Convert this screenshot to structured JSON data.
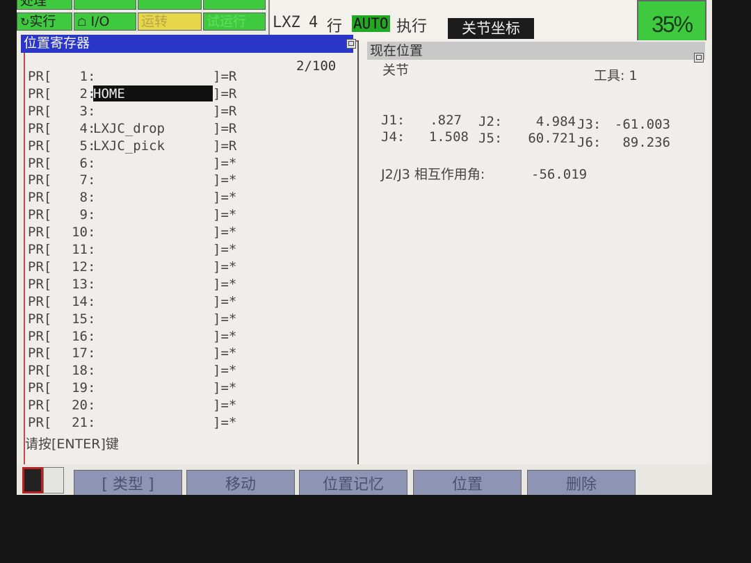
{
  "status_bar": {
    "buttons_row1": [
      "处理",
      "",
      "",
      ""
    ],
    "buttons_row2": [
      "实行",
      "I/O",
      "运转",
      "试运行"
    ],
    "program": "LXZ",
    "line_number": "4",
    "line_label": "行",
    "mode": "AUTO",
    "exec_state": "执行",
    "coord_mode": "关节坐标",
    "override": "35%"
  },
  "left_panel": {
    "title": "位置寄存器",
    "page_counter": "2/100",
    "prefix": "PR[",
    "rows": [
      {
        "num": "1",
        "comment": "",
        "suffix": "]=R"
      },
      {
        "num": "2",
        "comment": "HOME",
        "suffix": "]=R",
        "selected": true
      },
      {
        "num": "3",
        "comment": "",
        "suffix": "]=R"
      },
      {
        "num": "4",
        "comment": "LXJC_drop",
        "suffix": "]=R"
      },
      {
        "num": "5",
        "comment": "LXJC_pick",
        "suffix": "]=R"
      },
      {
        "num": "6",
        "comment": "",
        "suffix": "]=*"
      },
      {
        "num": "7",
        "comment": "",
        "suffix": "]=*"
      },
      {
        "num": "8",
        "comment": "",
        "suffix": "]=*"
      },
      {
        "num": "9",
        "comment": "",
        "suffix": "]=*"
      },
      {
        "num": "10",
        "comment": "",
        "suffix": "]=*"
      },
      {
        "num": "11",
        "comment": "",
        "suffix": "]=*"
      },
      {
        "num": "12",
        "comment": "",
        "suffix": "]=*"
      },
      {
        "num": "13",
        "comment": "",
        "suffix": "]=*"
      },
      {
        "num": "14",
        "comment": "",
        "suffix": "]=*"
      },
      {
        "num": "15",
        "comment": "",
        "suffix": "]=*"
      },
      {
        "num": "16",
        "comment": "",
        "suffix": "]=*"
      },
      {
        "num": "17",
        "comment": "",
        "suffix": "]=*"
      },
      {
        "num": "18",
        "comment": "",
        "suffix": "]=*"
      },
      {
        "num": "19",
        "comment": "",
        "suffix": "]=*"
      },
      {
        "num": "20",
        "comment": "",
        "suffix": "]=*"
      },
      {
        "num": "21",
        "comment": "",
        "suffix": "]=*"
      }
    ],
    "prompt": "请按[ENTER]键"
  },
  "right_panel": {
    "title": "现在位置",
    "position_type": "关节",
    "tool": "工具: 1",
    "joints": [
      {
        "label": "J1:",
        "value": ".827"
      },
      {
        "label": "J2:",
        "value": "4.984"
      },
      {
        "label": "J3:",
        "value": "-61.003"
      },
      {
        "label": "J4:",
        "value": "1.508"
      },
      {
        "label": "J5:",
        "value": "60.721"
      },
      {
        "label": "J6:",
        "value": "89.236"
      }
    ],
    "interaction_label": "J2/J3 相互作用角:",
    "interaction_value": "-56.019"
  },
  "function_keys": [
    "[ 类型 ]",
    "移动",
    "位置记忆",
    "位置",
    "删除"
  ],
  "colors": {
    "status_green": "#3fc93f",
    "title_blue": "#2a36c8",
    "selection_black": "#111111",
    "fkey_blue": "#8e95b4"
  }
}
